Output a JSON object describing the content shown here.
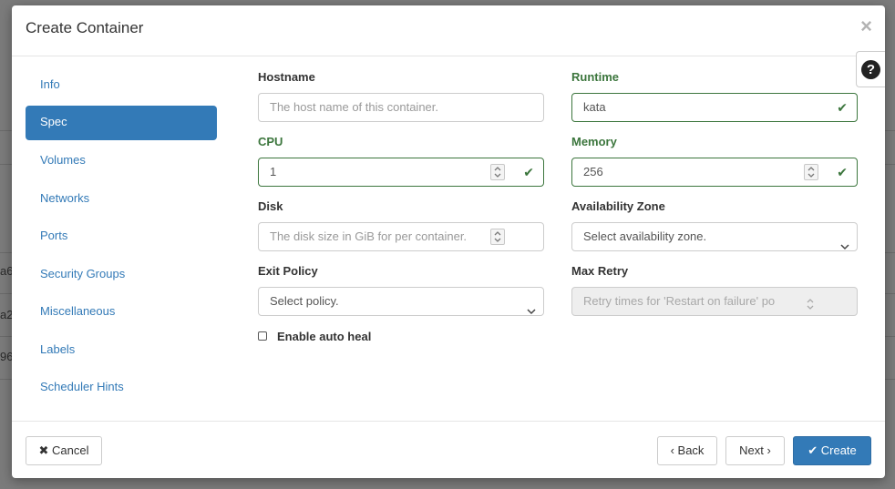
{
  "background": {
    "fragments": [
      "a6",
      "a2",
      "96"
    ]
  },
  "modal": {
    "title": "Create Container",
    "close_glyph": "×",
    "help_glyph": "?"
  },
  "nav": {
    "items": [
      {
        "label": "Info",
        "active": false
      },
      {
        "label": "Spec",
        "active": true
      },
      {
        "label": "Volumes",
        "active": false
      },
      {
        "label": "Networks",
        "active": false
      },
      {
        "label": "Ports",
        "active": false
      },
      {
        "label": "Security Groups",
        "active": false
      },
      {
        "label": "Miscellaneous",
        "active": false
      },
      {
        "label": "Labels",
        "active": false
      },
      {
        "label": "Scheduler Hints",
        "active": false
      }
    ]
  },
  "form": {
    "hostname": {
      "label": "Hostname",
      "value": "",
      "placeholder": "The host name of this container."
    },
    "runtime": {
      "label": "Runtime",
      "value": "kata",
      "valid": true
    },
    "cpu": {
      "label": "CPU",
      "value": "1",
      "valid": true
    },
    "memory": {
      "label": "Memory",
      "value": "256",
      "valid": true
    },
    "disk": {
      "label": "Disk",
      "value": "",
      "placeholder": "The disk size in GiB for per container."
    },
    "availability_zone": {
      "label": "Availability Zone",
      "selected": "Select availability zone."
    },
    "exit_policy": {
      "label": "Exit Policy",
      "selected": "Select policy."
    },
    "max_retry": {
      "label": "Max Retry",
      "placeholder": "Retry times for 'Restart on failure' po",
      "disabled": true
    },
    "auto_heal": {
      "label": "Enable auto heal",
      "checked": false
    }
  },
  "footer": {
    "cancel_label": "Cancel",
    "back_label": "Back",
    "next_label": "Next",
    "create_label": "Create"
  },
  "colors": {
    "primary": "#337ab7",
    "success": "#3c763d",
    "overlay": "#7b7b7b"
  }
}
